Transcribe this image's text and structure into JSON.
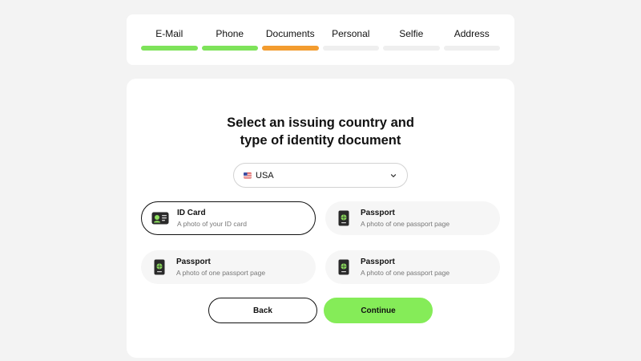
{
  "steps": [
    {
      "label": "E-Mail",
      "state": "done"
    },
    {
      "label": "Phone",
      "state": "done"
    },
    {
      "label": "Documents",
      "state": "active"
    },
    {
      "label": "Personal",
      "state": "pending"
    },
    {
      "label": "Selfie",
      "state": "pending"
    },
    {
      "label": "Address",
      "state": "pending"
    }
  ],
  "colors": {
    "done": "#7ee35a",
    "active": "#f39c2f",
    "pending": "#efefef",
    "continue_button": "#85ec58"
  },
  "title": {
    "line1": "Select an issuing country and",
    "line2": "type of identity document"
  },
  "country": {
    "value": "USA",
    "flag_icon": "us-flag-icon"
  },
  "documents": [
    {
      "title": "ID Card",
      "subtitle": "A photo of your ID card",
      "icon": "id-card-icon",
      "selected": true
    },
    {
      "title": "Passport",
      "subtitle": "A photo of one passport page",
      "icon": "passport-icon",
      "selected": false
    },
    {
      "title": "Passport",
      "subtitle": "A photo of one passport page",
      "icon": "passport-icon",
      "selected": false
    },
    {
      "title": "Passport",
      "subtitle": "A photo of one passport page",
      "icon": "passport-icon",
      "selected": false
    }
  ],
  "buttons": {
    "back": "Back",
    "continue": "Continue"
  }
}
